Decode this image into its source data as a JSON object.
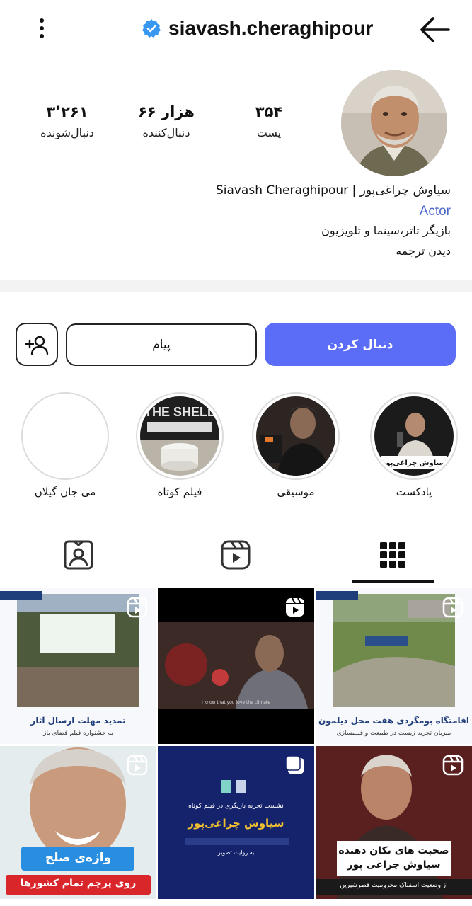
{
  "header": {
    "username": "siavash.cheraghipour",
    "menu_icon": "more-vertical-icon",
    "back_icon": "arrow-right-icon",
    "verified_icon": "verified-badge-icon",
    "verified_color": "#3897f0"
  },
  "stats": {
    "posts_value": "۳۵۴",
    "posts_label": "پست",
    "followers_value": "۶۶ هزار",
    "followers_label": "دنبال‌کننده",
    "following_value": "۳٬۲۶۱",
    "following_label": "دنبال‌شونده"
  },
  "bio": {
    "name": "سیاوش چراغی‌پور | Siavash Cheraghipour",
    "category": "Actor",
    "description": "بازیگر تاتر،سینما و تلویزیون",
    "translate": "دیدن ترجمه"
  },
  "actions": {
    "follow_label": "دنبال کردن",
    "message_label": "پیام",
    "add_user_icon": "add-user-icon",
    "accent_color": "#5b6cf6"
  },
  "highlights": [
    {
      "label": "پادکست",
      "thumb_text": "سیاوش چراغی‌پور"
    },
    {
      "label": "موسیقی"
    },
    {
      "label": "فیلم کوتاه",
      "thumb_text": "THE SHELL"
    },
    {
      "label": "می جان گیلان"
    }
  ],
  "tabs": [
    {
      "name": "grid",
      "icon": "grid-icon",
      "active": true
    },
    {
      "name": "reels",
      "icon": "reels-icon",
      "active": false
    },
    {
      "name": "tagged",
      "icon": "tagged-user-icon",
      "active": false
    }
  ],
  "posts": [
    {
      "type": "reel",
      "title": "اقامتگاه بومگردی هفت محل دیلمون",
      "subtitle": "میزبان تجربه زیست در طبیعت و فیلمسازی"
    },
    {
      "type": "reel",
      "subtitle": "I know that you love the climate"
    },
    {
      "type": "reel",
      "title": "تمدید مهلت ارسال آثار",
      "subtitle": "به جشنواره فیلم فضای باز"
    },
    {
      "type": "reel",
      "title": "صحبت های تکان دهنده سیاوش چراغی پور",
      "subtitle": "از وضعیت اسفناک محرومیت قصرشیرین"
    },
    {
      "type": "carousel",
      "title": "سیاوش چراغی‌پور",
      "subtitle": "نشست تجربه بازیگری در فیلم کوتاه",
      "footer": "به روایت تصویر"
    },
    {
      "type": "reel",
      "title": "واژه‌ی صلح",
      "subtitle": "روی پرچم تمام کشورها"
    }
  ]
}
